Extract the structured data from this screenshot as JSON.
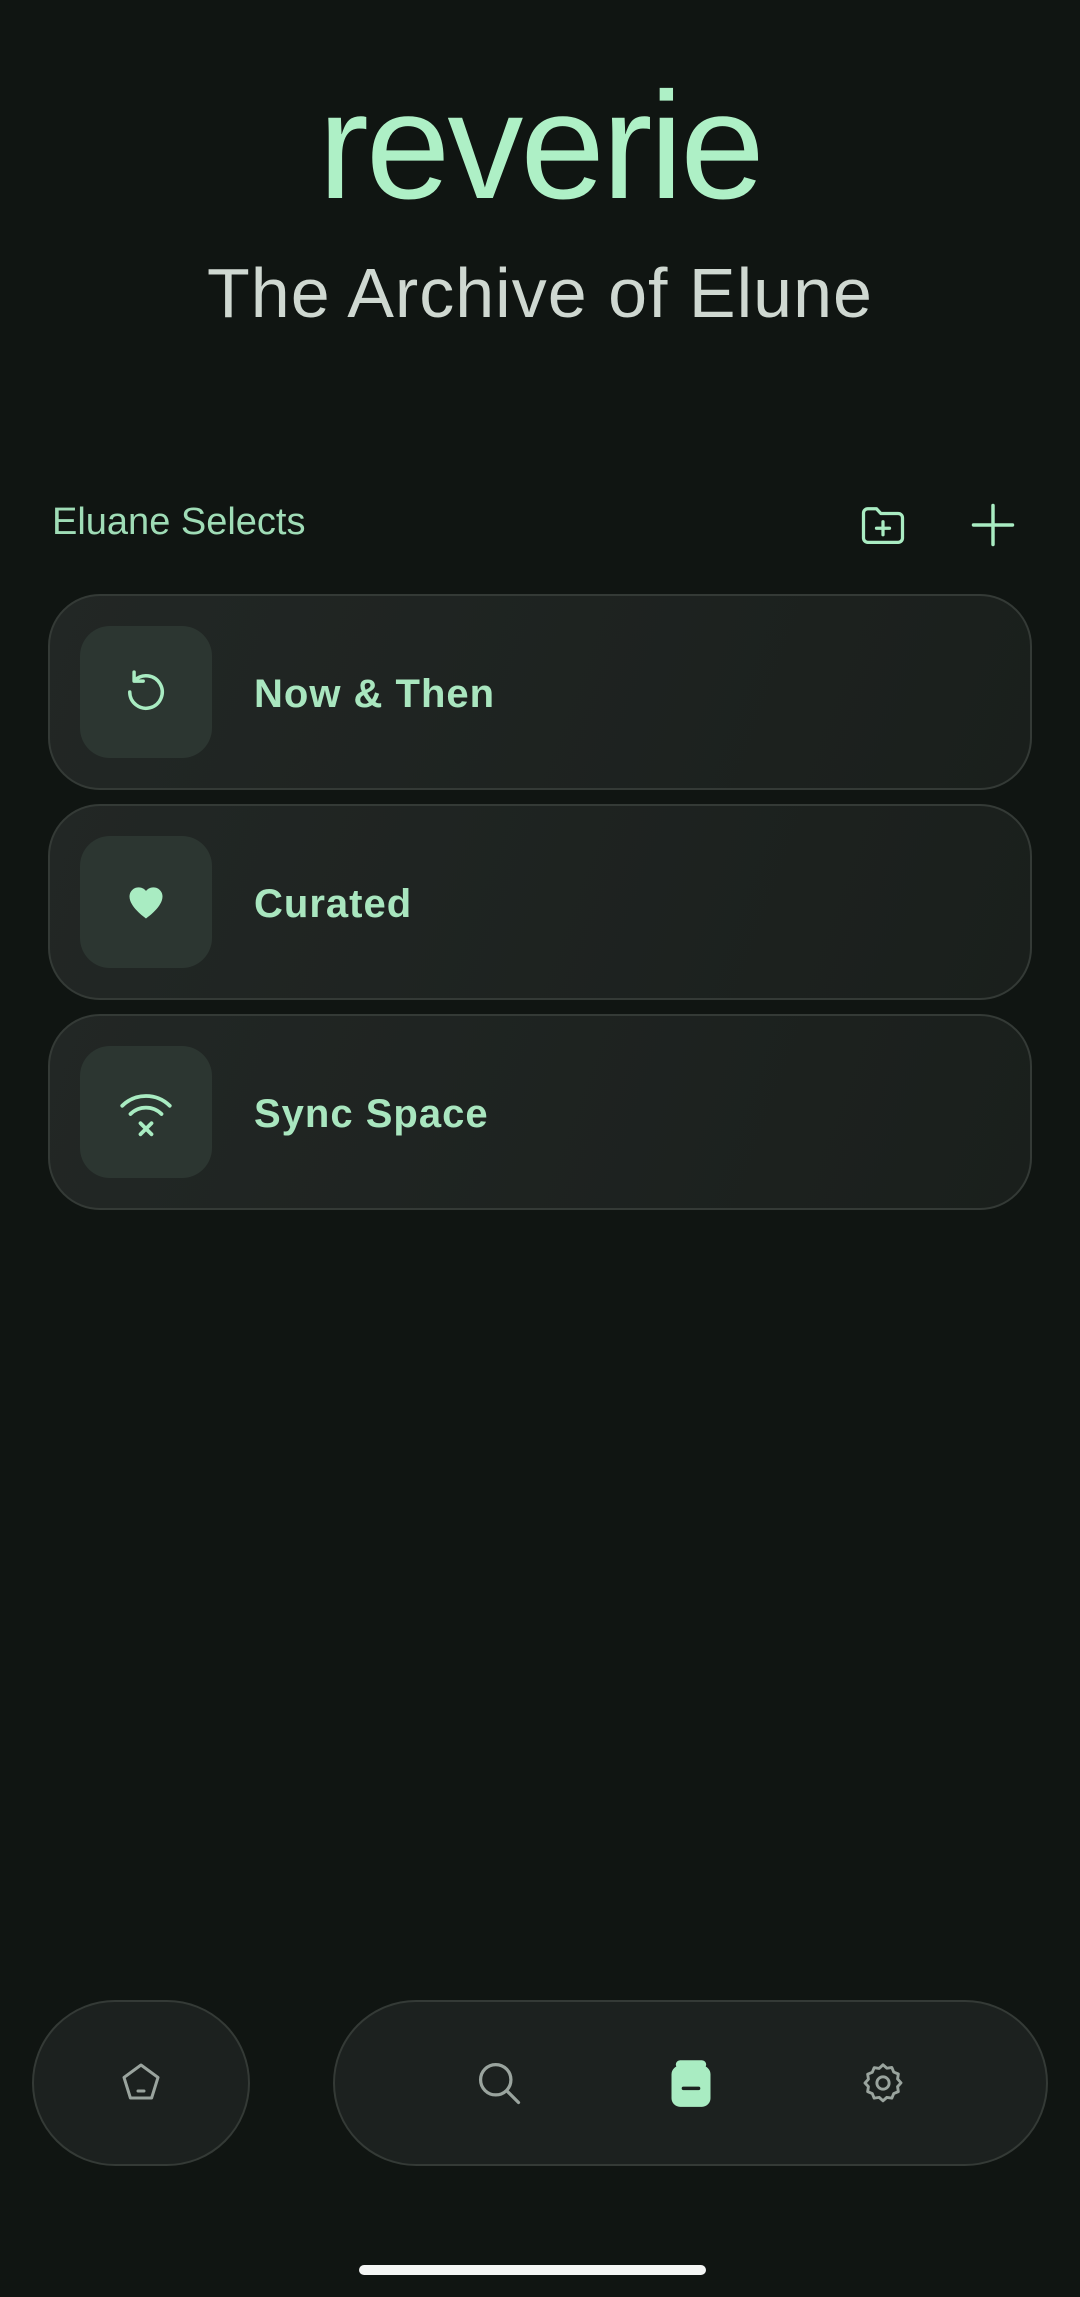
{
  "header": {
    "app_title": "reverie",
    "subtitle": "The Archive of Elune"
  },
  "section": {
    "title": "Eluane Selects",
    "actions": [
      {
        "icon": "folder-plus-icon"
      },
      {
        "icon": "plus-icon"
      }
    ]
  },
  "collections": [
    {
      "label": "Now & Then",
      "icon": "history-icon"
    },
    {
      "label": "Curated",
      "icon": "heart-icon"
    },
    {
      "label": "Sync Space",
      "icon": "wifi-off-icon"
    }
  ],
  "bottom_nav": {
    "home_icon": "pentagon-home-icon",
    "items": [
      {
        "icon": "search-icon",
        "active": false
      },
      {
        "icon": "library-icon",
        "active": true
      },
      {
        "icon": "settings-gear-icon",
        "active": false
      }
    ]
  },
  "colors": {
    "background": "#101512",
    "accent": "#a9ecc2",
    "card": "#1f2421",
    "icon_box": "#2c3631",
    "inactive_icon": "#9aa49e"
  }
}
